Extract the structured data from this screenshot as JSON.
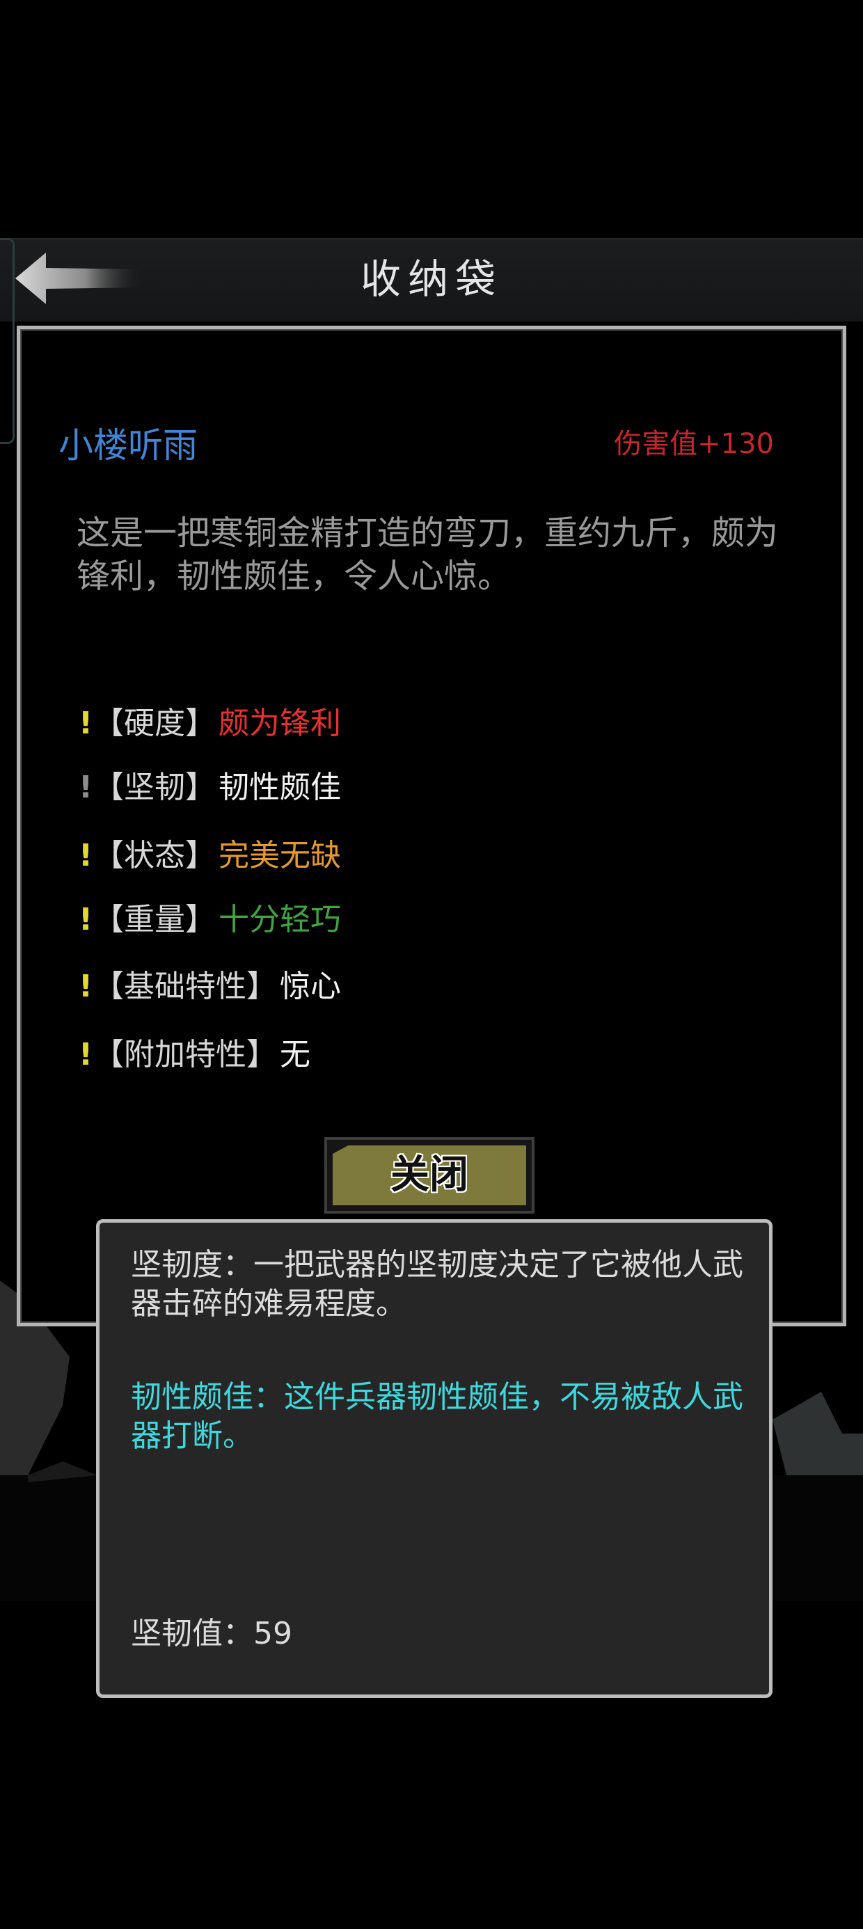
{
  "header": {
    "title": "收纳袋"
  },
  "item": {
    "name": "小楼听雨",
    "damage": "伤害值+130",
    "description": "这是一把寒铜金精打造的弯刀，重约九斤，颇为锋利，韧性颇佳，令人心惊。"
  },
  "attributes": [
    {
      "label": "【硬度】",
      "value": "颇为锋利",
      "color": "#e8312f"
    },
    {
      "label": "【坚韧】",
      "value": "韧性颇佳",
      "color": "#f2f2f2"
    },
    {
      "label": "【状态】",
      "value": "完美无缺",
      "color": "#e69a2e"
    },
    {
      "label": "【重量】",
      "value": "十分轻巧",
      "color": "#3fa540"
    },
    {
      "label": "【基础特性】",
      "value": "惊心",
      "color": "#f2f2f2"
    },
    {
      "label": "【附加特性】",
      "value": "无",
      "color": "#f2f2f2"
    }
  ],
  "attribute_mark": "!",
  "close_button": {
    "label": "关闭"
  },
  "tooltip": {
    "description": "坚韧度：一把武器的坚韧度决定了它被他人武器击碎的难易程度。",
    "grade": "韧性颇佳：这件兵器韧性颇佳，不易被敌人武器打断。",
    "stat": "坚韧值：59"
  },
  "colors": {
    "item_name": "#3f86d6",
    "damage": "#c8262b",
    "tooltip_grade": "#3fd8dc",
    "button_fill": "#7d7a3b",
    "mark_active": "#e3d830"
  }
}
